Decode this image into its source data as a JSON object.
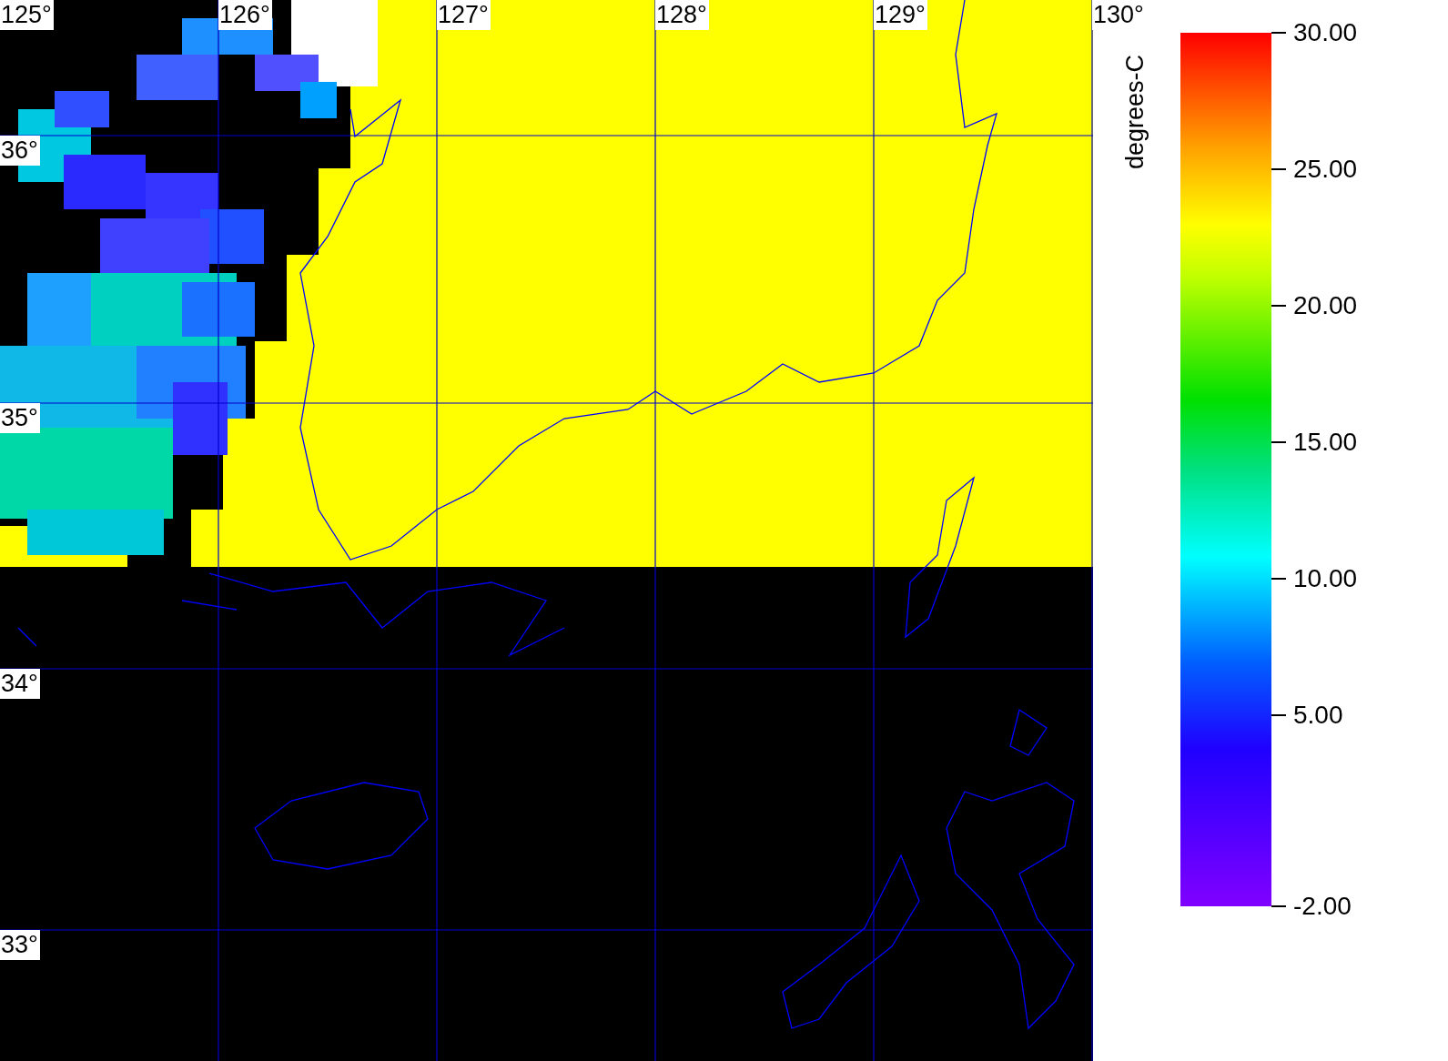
{
  "map": {
    "longitude_labels": [
      "125°",
      "126°",
      "127°",
      "128°",
      "129°",
      "130°"
    ],
    "latitude_labels": [
      "36°",
      "35°",
      "34°",
      "33°"
    ]
  },
  "colorbar": {
    "title": "degrees-C",
    "ticks": [
      "30.00",
      "25.00",
      "20.00",
      "15.00",
      "10.00",
      "5.00",
      "-2.00"
    ]
  }
}
